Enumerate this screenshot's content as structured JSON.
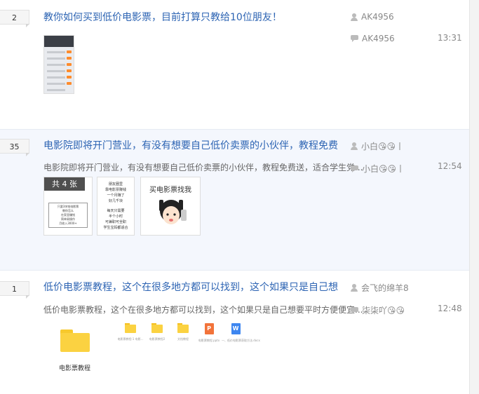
{
  "threads": [
    {
      "reply_count": "2",
      "title": "教你如何买到低价电影票，目前打算只教给10位朋友！",
      "author": "AK4956",
      "last_reply_user": "AK4956",
      "last_reply_time": "13:31"
    },
    {
      "reply_count": "35",
      "title": "电影院即将开门营业，有没有想要自己低价卖票的小伙伴，教程免费",
      "abstract": "电影院即将开门营业，有没有想要自己低价卖票的小伙伴，教程免费送，适合学生党...",
      "author": "小白😘😘丨",
      "last_reply_user": "小白😘😘丨",
      "last_reply_time": "12:54",
      "image_count_badge": "共 4 张",
      "image1_text": [
        "只要3块钱电影票",
        "教你怎么",
        "在家里赚钱",
        "简单易操作",
        "月收入3000+"
      ],
      "image2_text": [
        "朋友圈里",
        "靠电影票赚钱",
        "一个月赚了",
        "好几千块",
        "每天只需要",
        "半个小时",
        "可兼职可全职",
        "学生宝妈都适合"
      ],
      "image3_caption": "买电影票找我"
    },
    {
      "reply_count": "1",
      "title": "低价电影票教程，这个在很多地方都可以找到，这个如果只是自己想",
      "abstract": "低价电影票教程，这个在很多地方都可以找到，这个如果只是自己想要平时方便便宜...",
      "author": "会飞的绵羊8",
      "last_reply_user": "柒柒吖😘😘",
      "last_reply_time": "12:48",
      "folder_caption": "电影票教程",
      "files": [
        {
          "type": "folder",
          "name": "电影票教程-1 电影..."
        },
        {
          "type": "folder",
          "name": "电影票教程2"
        },
        {
          "type": "folder",
          "name": "文档教程"
        },
        {
          "type": "ppt",
          "label": "P",
          "name": "电影票教程.pptx"
        },
        {
          "type": "doc",
          "label": "W",
          "name": "一、低价电影票获取方法.docx"
        }
      ]
    }
  ]
}
